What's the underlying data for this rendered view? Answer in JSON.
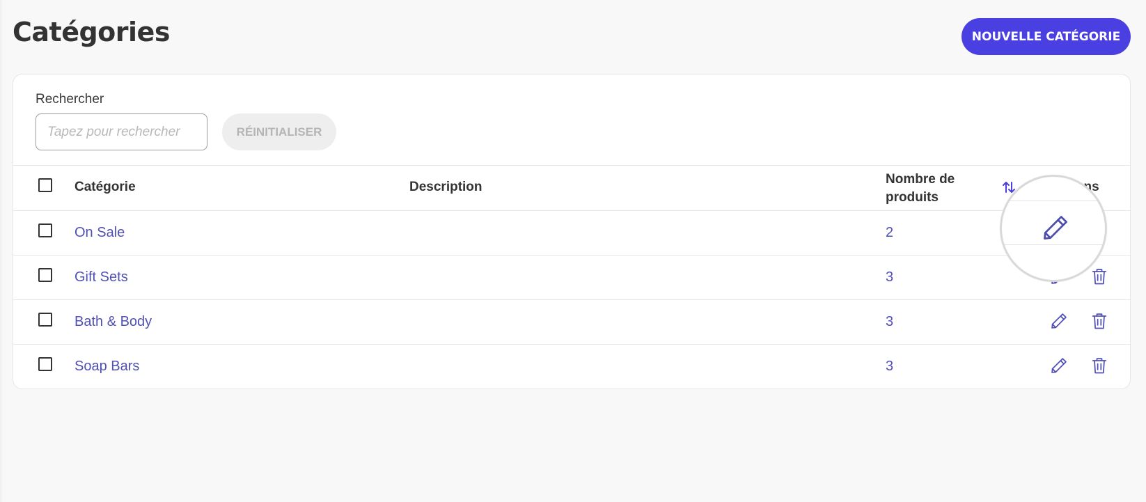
{
  "page": {
    "title": "Catégories",
    "new_button_label": "NOUVELLE CATÉGORIE"
  },
  "search": {
    "label": "Rechercher",
    "placeholder": "Tapez pour rechercher",
    "value": "",
    "reset_label": "RÉINITIALISER"
  },
  "table": {
    "columns": {
      "category": "Catégorie",
      "description": "Description",
      "count": "Nombre de produits",
      "actions": "Actions"
    },
    "rows": [
      {
        "name": "On Sale",
        "description": "",
        "count": "2"
      },
      {
        "name": "Gift Sets",
        "description": "",
        "count": "3"
      },
      {
        "name": "Bath & Body",
        "description": "",
        "count": "3"
      },
      {
        "name": "Soap Bars",
        "description": "",
        "count": "3"
      }
    ]
  },
  "icons": {
    "sort": "sort-arrows-icon",
    "edit": "pencil-icon",
    "delete": "trash-icon"
  },
  "colors": {
    "accent": "#4a3fe0",
    "link": "#5050b5",
    "background": "#f8f8f8"
  }
}
